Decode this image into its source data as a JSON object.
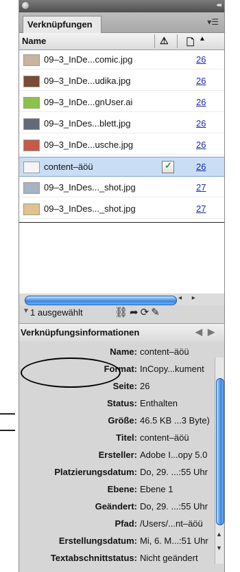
{
  "panel": {
    "tab_label": "Verknüpfungen",
    "columns": {
      "name": "Name",
      "warning_icon": "warning-icon",
      "page_icon": "page-icon"
    }
  },
  "links": [
    {
      "file": "09–3_InDe...comic.jpg",
      "page": "26",
      "thumb_color": "#c9b49b"
    },
    {
      "file": "09–3_InDe...udika.jpg",
      "page": "26",
      "thumb_color": "#7a4b35"
    },
    {
      "file": "09–3_InDe...gnUser.ai",
      "page": "26",
      "thumb_color": "#8bc34a"
    },
    {
      "file": "09–3_InDes...blett.jpg",
      "page": "26",
      "thumb_color": "#5f6b7a"
    },
    {
      "file": "09–3_InDe...usche.jpg",
      "page": "26",
      "thumb_color": "#c45a4a"
    },
    {
      "file": "content–äöü",
      "page": "26",
      "thumb_color": "#f5f5f5",
      "selected": true
    },
    {
      "file": "09–3_InDes..._shot.jpg",
      "page": "27",
      "thumb_color": "#a5b3c4"
    },
    {
      "file": "09–3_InDes..._shot.jpg",
      "page": "27",
      "thumb_color": "#e2c28c"
    }
  ],
  "selection": {
    "label": "1 ausgewählt"
  },
  "info": {
    "header": "Verknüpfungsinformationen",
    "rows": [
      {
        "key": "Name:",
        "value": "content–äöü"
      },
      {
        "key": "Format:",
        "value": "InCopy...kument"
      },
      {
        "key": "Seite:",
        "value": "26"
      },
      {
        "key": "Status:",
        "value": "Enthalten"
      },
      {
        "key": "Größe:",
        "value": "46.5 KB ...3 Byte)"
      },
      {
        "key": "Titel:",
        "value": "content–äöü"
      },
      {
        "key": "Ersteller:",
        "value": "Adobe I...opy 5.0"
      },
      {
        "key": "Platzierungsdatum:",
        "value": "Do, 29. ...:55 Uhr"
      },
      {
        "key": "Ebene:",
        "value": "Ebene 1"
      },
      {
        "key": "Geändert:",
        "value": "Do, 29. ...:55 Uhr"
      },
      {
        "key": "Pfad:",
        "value": "/Users/...nt–äöü"
      },
      {
        "key": "Erstellungsdatum:",
        "value": "Mi, 6. M...:51 Uhr"
      },
      {
        "key": "Textabschnittstatus:",
        "value": "Nicht geändert"
      }
    ]
  }
}
